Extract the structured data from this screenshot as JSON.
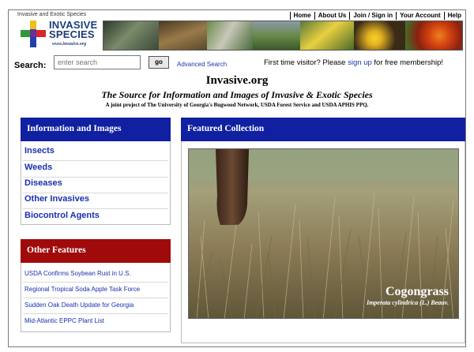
{
  "header": {
    "tagline": "Invasive and Exotic Species",
    "logo_line1": "INVASIVE",
    "logo_line2": "SPECIES",
    "logo_url": "www.invasive.org",
    "nav": [
      "Home",
      "About Us",
      "Join / Sign in",
      "Your Account",
      "Help"
    ]
  },
  "search": {
    "label": "Search:",
    "placeholder": "enter search",
    "go_label": "go",
    "advanced_label": "Advanced Search"
  },
  "membership": {
    "prefix": "First time visitor? Please ",
    "link": "sign up",
    "suffix": " for free membership!"
  },
  "title": {
    "site": "Invasive.org",
    "subtitle": "The Source for Information and Images of Invasive & Exotic Species",
    "joint": "A joint project of The University of Georgia's Bugwood Network, USDA Forest Service and USDA APHIS PPQ."
  },
  "info_panel": {
    "heading": "Information and Images",
    "items": [
      "Insects",
      "Weeds",
      "Diseases",
      "Other Invasives",
      "Biocontrol Agents"
    ]
  },
  "other_panel": {
    "heading": "Other Features",
    "items": [
      "USDA Confirms Soybean Rust in U.S.",
      "Regional Tropical Soda Apple Task Force",
      "Sudden Oak Death Update for Georgia",
      "Mid-Atlantic EPPC Plant List"
    ]
  },
  "featured": {
    "heading": "Featured Collection",
    "common_name": "Cogongrass",
    "scientific_name": "Imperata cylindrica (L.) Beauv."
  },
  "colors": {
    "blue_header": "#1020a0",
    "red_header": "#a00a0a",
    "link": "#1a2fb0"
  }
}
